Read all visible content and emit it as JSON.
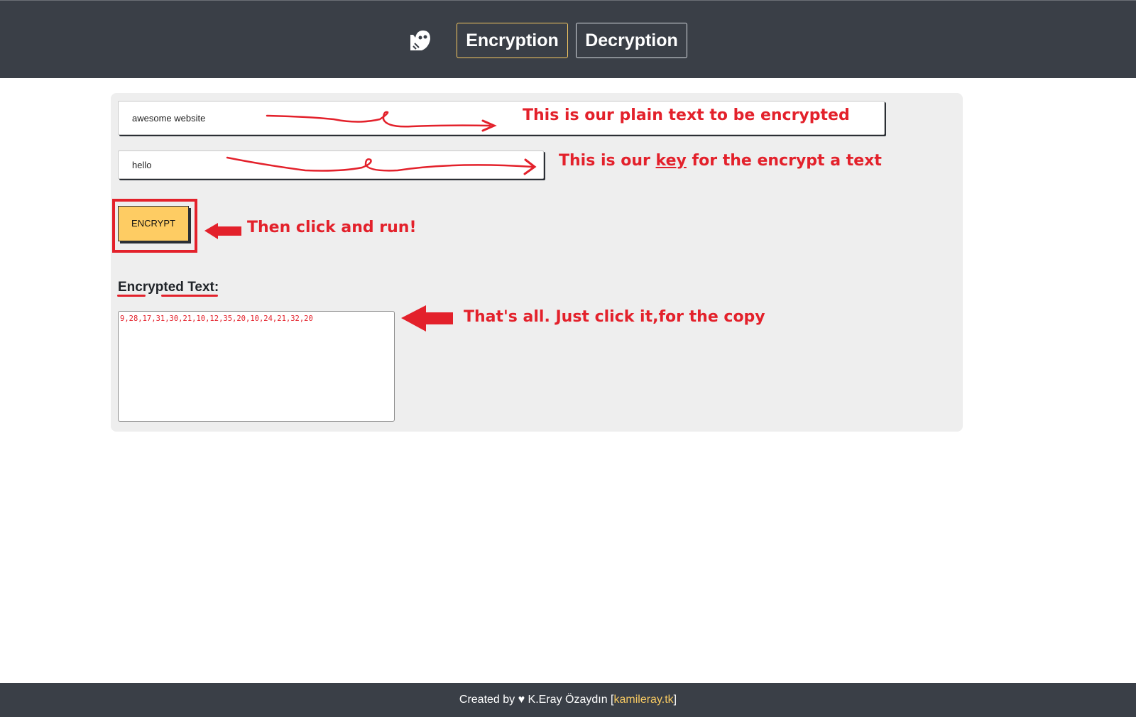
{
  "header": {
    "logo_icon": "ghost-icon",
    "tabs": [
      {
        "label": "Encryption",
        "active": true
      },
      {
        "label": "Decryption",
        "active": false
      }
    ],
    "accent_color": "#f5c862",
    "background_color": "#3a3f47"
  },
  "form": {
    "plain_text_value": "awesome website",
    "key_value": "hello",
    "encrypt_button_label": "ENCRYPT",
    "button_color": "#fecc63",
    "output_label": "Encrypted Text:",
    "output_value": "9,28,17,31,30,21,10,12,35,20,10,24,21,32,20"
  },
  "annotations": {
    "plain_text_note": "This is our plain text to be encrypted",
    "key_note_prefix": "This is our ",
    "key_note_keyword": "key",
    "key_note_suffix": " for the encrypt a text",
    "run_note": "Then click and run!",
    "copy_note": "That's all. Just click it,for the copy",
    "annotation_color": "#e3212b"
  },
  "footer": {
    "created_prefix": "Created by ♥ K.Eray Özaydın [",
    "link_text": "kamileray.tk",
    "created_suffix": "]"
  }
}
